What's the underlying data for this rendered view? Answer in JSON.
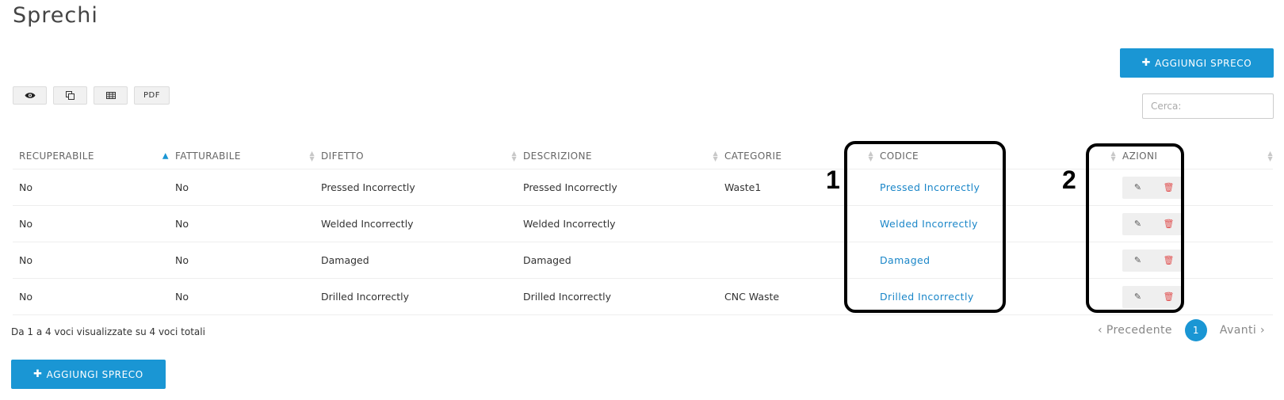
{
  "page": {
    "title": "Sprechi"
  },
  "add_button": {
    "icon": "plus-icon",
    "label": "AGGIUNGI SPRECO"
  },
  "toolbar": {
    "view_icon": "eye-icon",
    "copy_icon": "copy-icon",
    "csv_icon": "table-icon",
    "pdf_label": "PDF"
  },
  "search": {
    "placeholder": "Cerca:",
    "value": ""
  },
  "table": {
    "columns": [
      "RECUPERABILE",
      "FATTURABILE",
      "DIFETTO",
      "DESCRIZIONE",
      "CATEGORIE",
      "CODICE",
      "AZIONI"
    ],
    "rows": [
      {
        "recuperabile": "No",
        "fatturabile": "No",
        "difetto": "Pressed Incorrectly",
        "descrizione": "Pressed Incorrectly",
        "categorie": "Waste1",
        "codice": "Pressed Incorrectly"
      },
      {
        "recuperabile": "No",
        "fatturabile": "No",
        "difetto": "Welded Incorrectly",
        "descrizione": "Welded Incorrectly",
        "categorie": "",
        "codice": "Welded Incorrectly"
      },
      {
        "recuperabile": "No",
        "fatturabile": "No",
        "difetto": "Damaged",
        "descrizione": "Damaged",
        "categorie": "",
        "codice": "Damaged"
      },
      {
        "recuperabile": "No",
        "fatturabile": "No",
        "difetto": "Drilled Incorrectly",
        "descrizione": "Drilled Incorrectly",
        "categorie": "CNC Waste",
        "codice": "Drilled Incorrectly"
      }
    ],
    "row_actions": {
      "edit_icon": "edit-icon",
      "delete_icon": "trash-icon"
    }
  },
  "annotations": {
    "label_1": "1",
    "label_2": "2"
  },
  "footer": {
    "info": "Da 1 a 4 voci visualizzate su 4 voci totali",
    "prev": "Precedente",
    "page": "1",
    "next": "Avanti"
  },
  "colors": {
    "accent": "#1a96d4",
    "link": "#1a86c8",
    "delete": "#e05050"
  }
}
